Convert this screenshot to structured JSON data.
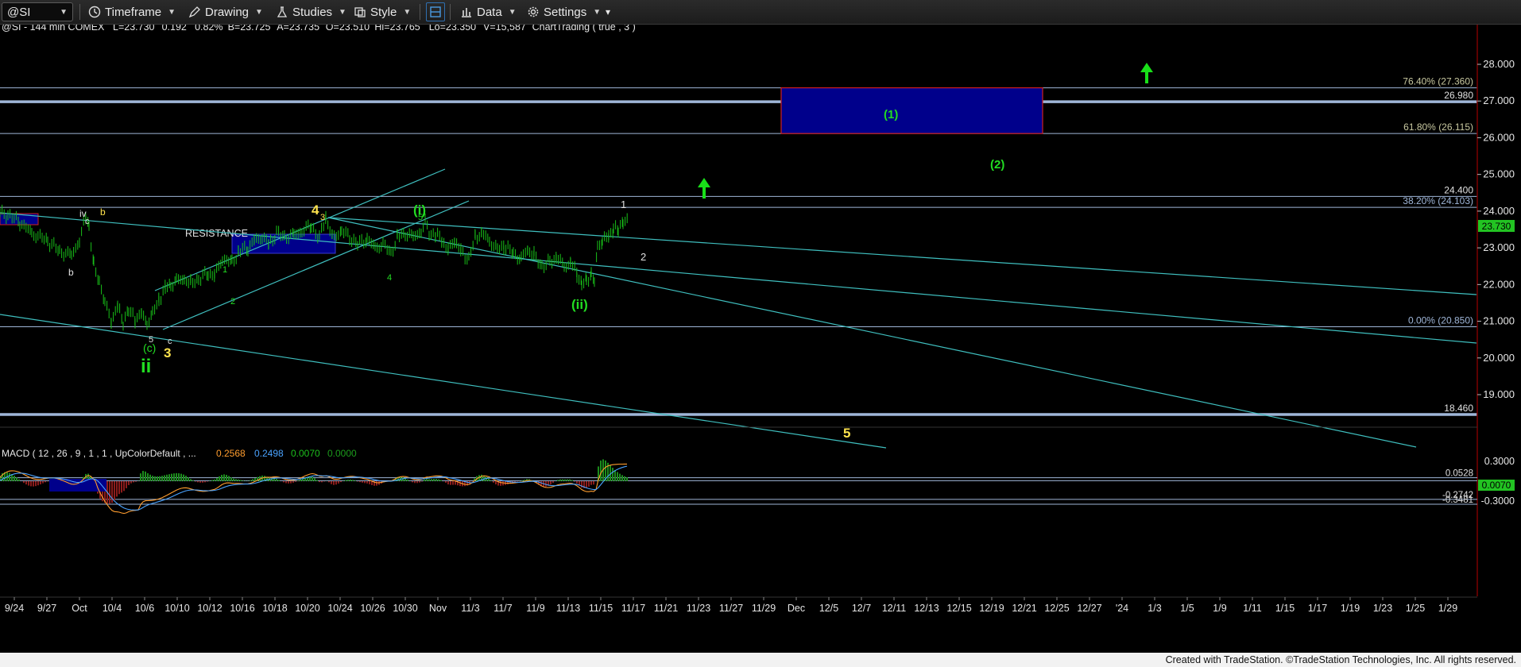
{
  "toolbar": {
    "symbol": "@SI",
    "timeframe_label": "Timeframe",
    "drawing_label": "Drawing",
    "studies_label": "Studies",
    "style_label": "Style",
    "data_label": "Data",
    "settings_label": "Settings"
  },
  "header": {
    "symbol_info": "@SI - 144 min  COMEX",
    "fields": [
      {
        "label": "L=",
        "value": "23.730"
      },
      {
        "label": "",
        "value": "0.192"
      },
      {
        "label": "",
        "value": "0.82%"
      },
      {
        "label": "B=",
        "value": "23.725"
      },
      {
        "label": "A=",
        "value": "23.735"
      },
      {
        "label": "O=",
        "value": "23.510"
      },
      {
        "label": "Hi=",
        "value": "23.765"
      },
      {
        "label": "Lo=",
        "value": "23.350"
      },
      {
        "label": "V=",
        "value": "15,587"
      }
    ],
    "extra": "ChartTrading ( true , 3 )"
  },
  "macd_header": {
    "label": "MACD ( 12 , 26 , 9 , 1 , 1 , UpColorDefault , ...",
    "values": [
      "0.2568",
      "0.2498",
      "0.0070",
      "0.0000"
    ]
  },
  "colors": {
    "price_bars": "#18c018",
    "trendlines": "#3fbfbf",
    "level_lines": "#9fb6d8",
    "box_fill": "#00008b",
    "box_border": "#d02020",
    "wave_green": "#22dd22",
    "wave_yellow": "#ffe34d",
    "macd_line": "#ff9d2e",
    "signal_line": "#4aa3ff",
    "hist_pos": "#1c8c1c",
    "hist_neg": "#8c1c1c",
    "last_price_tag": "#22c322"
  },
  "chart_data": {
    "type": "ohlc",
    "price_axis": {
      "range": [
        17.7,
        28.7
      ],
      "ticks": [
        "28.000",
        "27.000",
        "26.000",
        "25.000",
        "24.000",
        "23.000",
        "22.000",
        "21.000",
        "20.000",
        "19.000"
      ]
    },
    "time_axis": {
      "ticks": [
        "9/24",
        "9/27",
        "Oct",
        "10/4",
        "10/6",
        "10/10",
        "10/12",
        "10/16",
        "10/18",
        "10/20",
        "10/24",
        "10/26",
        "10/30",
        "Nov",
        "11/3",
        "11/7",
        "11/9",
        "11/13",
        "11/15",
        "11/17",
        "11/21",
        "11/23",
        "11/27",
        "11/29",
        "Dec",
        "12/5",
        "12/7",
        "12/11",
        "12/13",
        "12/15",
        "12/19",
        "12/21",
        "12/25",
        "12/27",
        "'24",
        "1/3",
        "1/5",
        "1/9",
        "1/11",
        "1/15",
        "1/17",
        "1/19",
        "1/23",
        "1/25",
        "1/29"
      ]
    },
    "last_price": "23.730",
    "price_path_points": [
      [
        0,
        23.95
      ],
      [
        10,
        23.9
      ],
      [
        25,
        23.7
      ],
      [
        40,
        23.4
      ],
      [
        60,
        23.2
      ],
      [
        75,
        22.9
      ],
      [
        90,
        22.8
      ],
      [
        100,
        23.2
      ],
      [
        108,
        23.85
      ],
      [
        112,
        23.6
      ],
      [
        118,
        22.5
      ],
      [
        125,
        22.1
      ],
      [
        132,
        21.5
      ],
      [
        140,
        21.0
      ],
      [
        148,
        21.4
      ],
      [
        155,
        21.0
      ],
      [
        162,
        21.3
      ],
      [
        170,
        21.05
      ],
      [
        178,
        21.2
      ],
      [
        185,
        20.95
      ],
      [
        192,
        21.2
      ],
      [
        200,
        21.6
      ],
      [
        208,
        21.9
      ],
      [
        215,
        22.0
      ],
      [
        222,
        22.1
      ],
      [
        232,
        22.15
      ],
      [
        240,
        22.05
      ],
      [
        250,
        22.15
      ],
      [
        262,
        22.3
      ],
      [
        270,
        22.25
      ],
      [
        280,
        22.7
      ],
      [
        292,
        22.6
      ],
      [
        300,
        22.9
      ],
      [
        312,
        23.0
      ],
      [
        320,
        23.2
      ],
      [
        330,
        23.3
      ],
      [
        338,
        23.1
      ],
      [
        348,
        23.4
      ],
      [
        358,
        23.3
      ],
      [
        370,
        23.35
      ],
      [
        380,
        23.45
      ],
      [
        392,
        23.6
      ],
      [
        402,
        23.25
      ],
      [
        410,
        23.85
      ],
      [
        418,
        23.3
      ],
      [
        430,
        23.45
      ],
      [
        440,
        23.3
      ],
      [
        450,
        23.1
      ],
      [
        462,
        23.25
      ],
      [
        472,
        23.0
      ],
      [
        482,
        23.1
      ],
      [
        492,
        22.85
      ],
      [
        500,
        23.3
      ],
      [
        510,
        23.4
      ],
      [
        520,
        23.3
      ],
      [
        530,
        23.45
      ],
      [
        535,
        23.7
      ],
      [
        540,
        23.4
      ],
      [
        548,
        23.35
      ],
      [
        556,
        23.2
      ],
      [
        564,
        22.95
      ],
      [
        572,
        23.2
      ],
      [
        580,
        22.9
      ],
      [
        590,
        22.7
      ],
      [
        598,
        23.3
      ],
      [
        606,
        23.4
      ],
      [
        616,
        23.2
      ],
      [
        626,
        22.95
      ],
      [
        634,
        23.05
      ],
      [
        646,
        22.85
      ],
      [
        656,
        22.7
      ],
      [
        664,
        22.95
      ],
      [
        672,
        22.8
      ],
      [
        682,
        22.5
      ],
      [
        692,
        22.6
      ],
      [
        700,
        22.75
      ],
      [
        710,
        22.5
      ],
      [
        718,
        22.6
      ],
      [
        726,
        22.3
      ],
      [
        732,
        22.0
      ],
      [
        738,
        22.1
      ],
      [
        744,
        22.3
      ],
      [
        748,
        22.05
      ],
      [
        752,
        23.05
      ],
      [
        758,
        23.2
      ],
      [
        766,
        23.3
      ],
      [
        772,
        23.55
      ],
      [
        778,
        23.45
      ],
      [
        784,
        23.75
      ],
      [
        790,
        23.73
      ]
    ],
    "price_levels": [
      {
        "label": "76.40% (27.360)",
        "value": 27.36
      },
      {
        "label": "26.980",
        "value": 26.98
      },
      {
        "label": "61.80% (26.115)",
        "value": 26.115
      },
      {
        "label": "24.400",
        "value": 24.4
      },
      {
        "label": "38.20% (24.103)",
        "value": 24.103
      },
      {
        "label": "0.00% (20.850)",
        "value": 20.85
      },
      {
        "label": "18.460",
        "value": 18.46
      }
    ],
    "target_box": {
      "top": 27.36,
      "bottom": 26.115,
      "label": "(1)"
    },
    "resistance_label": "RESISTANCE",
    "wave_labels": [
      {
        "text": "(1)",
        "color": "green"
      },
      {
        "text": "(2)",
        "color": "green"
      },
      {
        "text": "(i)",
        "color": "green"
      },
      {
        "text": "(ii)",
        "color": "green"
      },
      {
        "text": "ii",
        "color": "green"
      },
      {
        "text": "(c)",
        "color": "green"
      },
      {
        "text": "4",
        "color": "yellow"
      },
      {
        "text": "3",
        "color": "yellow"
      },
      {
        "text": "5",
        "color": "yellow"
      },
      {
        "text": "1",
        "color": "white"
      },
      {
        "text": "2",
        "color": "white"
      },
      {
        "text": "iv",
        "color": "white"
      },
      {
        "text": "b",
        "color": "yellow"
      },
      {
        "text": "c",
        "color": "white"
      },
      {
        "text": "b",
        "color": "white"
      },
      {
        "text": "5",
        "color": "white"
      },
      {
        "text": "c",
        "color": "white"
      },
      {
        "text": "1",
        "color": "green"
      },
      {
        "text": "2",
        "color": "green"
      },
      {
        "text": "3",
        "color": "yellow"
      },
      {
        "text": "4",
        "color": "green"
      },
      {
        "text": "5",
        "color": "green"
      }
    ],
    "macd": {
      "axis_ticks": [
        "0.3000",
        "-0.3000"
      ],
      "levels": [
        {
          "label": "0.0528",
          "value": 0.0528
        },
        {
          "label": "0.0070",
          "value": 0.007
        },
        {
          "label": "-0.2742",
          "value": -0.2742
        },
        {
          "label": "-0.3481",
          "value": -0.3481
        }
      ]
    }
  },
  "footer": {
    "text": "Created with TradeStation. ©TradeStation Technologies, Inc. All rights reserved."
  }
}
